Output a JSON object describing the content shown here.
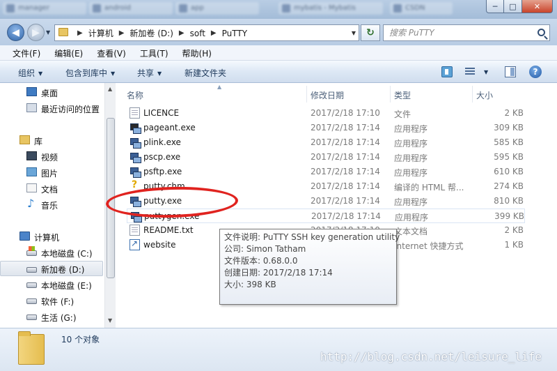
{
  "background_tabs": [
    "manager",
    "android",
    "app",
    "mybatis - Mybatis",
    "CSDN"
  ],
  "window_controls": {
    "minimize": "─",
    "maximize": "□",
    "close": "✕"
  },
  "address": {
    "crumbs": [
      "计算机",
      "新加卷 (D:)",
      "soft",
      "PuTTY"
    ],
    "search_placeholder": "搜索 PuTTY"
  },
  "menu": [
    "文件(F)",
    "编辑(E)",
    "查看(V)",
    "工具(T)",
    "帮助(H)"
  ],
  "commands": {
    "organize": "组织",
    "include_in_library": "包含到库中",
    "share": "共享",
    "new_folder": "新建文件夹"
  },
  "nav": {
    "favorites": [
      {
        "label": "桌面",
        "icon": "desktop-icon"
      },
      {
        "label": "最近访问的位置",
        "icon": "recent-places-icon"
      }
    ],
    "libraries_label": "库",
    "libraries": [
      {
        "label": "视频",
        "icon": "video-icon"
      },
      {
        "label": "图片",
        "icon": "pictures-icon"
      },
      {
        "label": "文档",
        "icon": "documents-icon"
      },
      {
        "label": "音乐",
        "icon": "music-icon"
      }
    ],
    "computer_label": "计算机",
    "drives": [
      "本地磁盘 (C:)",
      "新加卷 (D:)",
      "本地磁盘 (E:)",
      "软件 (F:)",
      "生活 (G:)"
    ],
    "selected_drive_index": 1
  },
  "columns": {
    "name": "名称",
    "date": "修改日期",
    "type": "类型",
    "size": "大小"
  },
  "files": [
    {
      "name": "LICENCE",
      "date": "2017/2/18 17:10",
      "type": "文件",
      "size": "2 KB",
      "icon": "text-file-icon"
    },
    {
      "name": "pageant.exe",
      "date": "2017/2/18 17:14",
      "type": "应用程序",
      "size": "309 KB",
      "icon": "pageant-icon"
    },
    {
      "name": "plink.exe",
      "date": "2017/2/18 17:14",
      "type": "应用程序",
      "size": "585 KB",
      "icon": "putty-app-icon"
    },
    {
      "name": "pscp.exe",
      "date": "2017/2/18 17:14",
      "type": "应用程序",
      "size": "595 KB",
      "icon": "putty-app-icon"
    },
    {
      "name": "psftp.exe",
      "date": "2017/2/18 17:14",
      "type": "应用程序",
      "size": "610 KB",
      "icon": "putty-app-icon"
    },
    {
      "name": "putty.chm",
      "date": "2017/2/18 17:14",
      "type": "编译的 HTML 帮...",
      "size": "274 KB",
      "icon": "help-file-icon"
    },
    {
      "name": "putty.exe",
      "date": "2017/2/18 17:14",
      "type": "应用程序",
      "size": "810 KB",
      "icon": "putty-app-icon"
    },
    {
      "name": "puttygen.exe",
      "date": "2017/2/18 17:14",
      "type": "应用程序",
      "size": "399 KB",
      "icon": "putty-app-icon"
    },
    {
      "name": "README.txt",
      "date": "2017/2/18 17:10",
      "type": "文本文档",
      "size": "2 KB",
      "icon": "text-file-icon"
    },
    {
      "name": "website",
      "date": "",
      "type": "Internet 快捷方式",
      "size": "1 KB",
      "icon": "shortcut-icon"
    }
  ],
  "hovered_row_index": 7,
  "tooltip": [
    "文件说明: PuTTY SSH key generation utility",
    "公司: Simon Tatham",
    "文件版本: 0.68.0.0",
    "创建日期: 2017/2/18 17:14",
    "大小: 398 KB"
  ],
  "details": {
    "count": "10 个对象"
  },
  "watermark": "http://blog.csdn.net/leisure_life",
  "colors": {
    "annotation": "#e0231f",
    "accent": "#1e395b"
  }
}
